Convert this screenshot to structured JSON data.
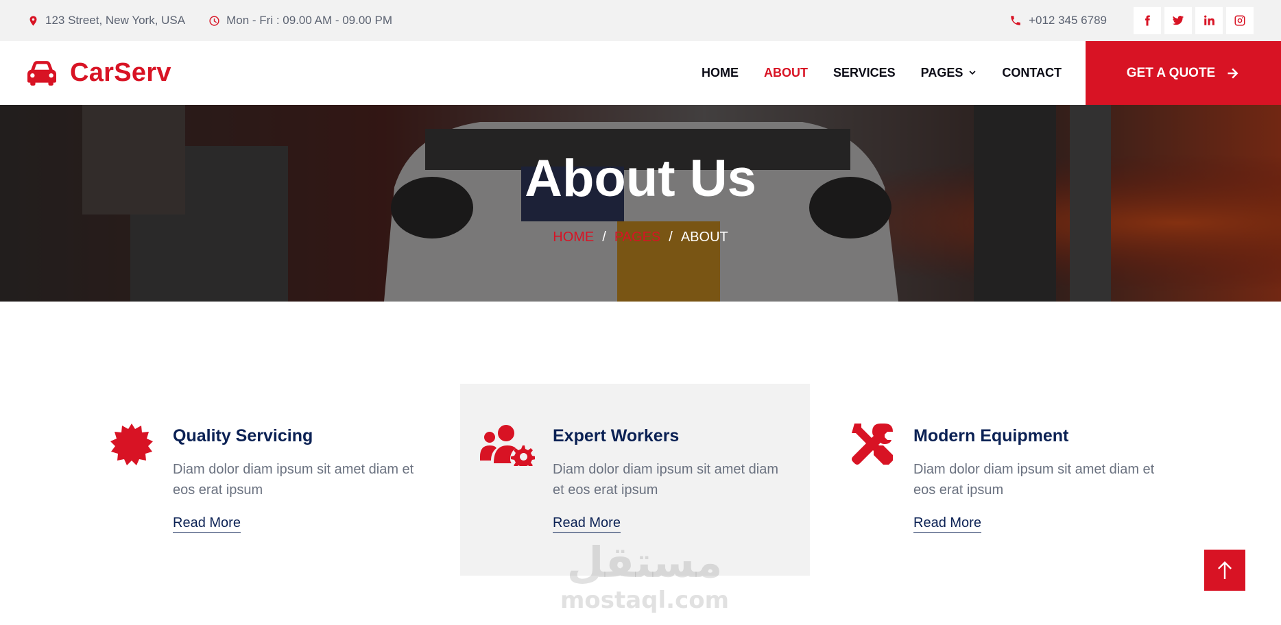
{
  "topbar": {
    "address": "123 Street, New York, USA",
    "hours": "Mon - Fri : 09.00 AM - 09.00 PM",
    "phone": "+012 345 6789",
    "social": [
      "facebook-icon",
      "twitter-icon",
      "linkedin-icon",
      "instagram-icon"
    ]
  },
  "navbar": {
    "brand": "CarServ",
    "links": [
      {
        "label": "HOME",
        "active": false
      },
      {
        "label": "ABOUT",
        "active": true
      },
      {
        "label": "SERVICES",
        "active": false
      },
      {
        "label": "PAGES",
        "active": false,
        "dropdown": true
      },
      {
        "label": "CONTACT",
        "active": false
      }
    ],
    "quote_label": "GET A QUOTE"
  },
  "hero": {
    "title": "About Us",
    "breadcrumb": {
      "home": "HOME",
      "pages": "PAGES",
      "current": "ABOUT",
      "separator": "/"
    }
  },
  "features": [
    {
      "icon": "certificate-icon",
      "title": "Quality Servicing",
      "text": "Diam dolor diam ipsum sit amet diam et eos erat ipsum",
      "link": "Read More",
      "highlighted": false
    },
    {
      "icon": "users-cog-icon",
      "title": "Expert Workers",
      "text": "Diam dolor diam ipsum sit amet diam et eos erat ipsum",
      "link": "Read More",
      "highlighted": true
    },
    {
      "icon": "tools-icon",
      "title": "Modern Equipment",
      "text": "Diam dolor diam ipsum sit amet diam et eos erat ipsum",
      "link": "Read More",
      "highlighted": false
    }
  ],
  "watermark": {
    "arabic": "مستقل",
    "latin": "mostaql.com"
  },
  "colors": {
    "primary": "#d81324",
    "dark": "#0b2154",
    "topbar_bg": "#f2f2f2",
    "muted_text": "#6b7280"
  }
}
